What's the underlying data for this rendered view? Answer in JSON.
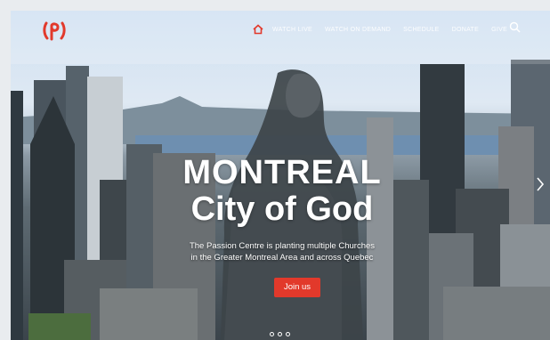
{
  "nav": {
    "logo_icon": "passion-centre-logo",
    "home_icon": "home-icon",
    "items": [
      {
        "label": "WATCH LIVE"
      },
      {
        "label": "WATCH ON DEMAND"
      },
      {
        "label": "SCHEDULE"
      },
      {
        "label": "DONATE"
      },
      {
        "label": "GIVE"
      }
    ],
    "search_icon": "search-icon"
  },
  "hero": {
    "title_line1": "MONTREAL",
    "title_line2": "City of God",
    "subtitle_line1": "The Passion Centre is planting multiple Churches",
    "subtitle_line2": "in the Greater Montreal Area and across Quebec",
    "cta_label": "Join us"
  },
  "carousel": {
    "dot_count": 3,
    "next_icon": "chevron-right-icon"
  },
  "colors": {
    "brand": "#e2392b",
    "nav_text": "#ffffff"
  }
}
